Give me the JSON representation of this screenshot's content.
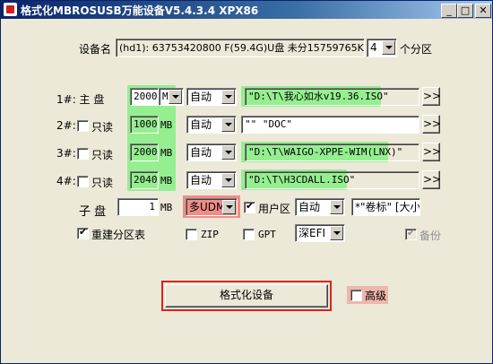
{
  "window": {
    "title": "格式化MBROSUSB万能设备V5.4.3.4 XPX86",
    "minimize_label": "_",
    "maximize_label": "□",
    "close_label": "✕"
  },
  "device": {
    "label": "设备名",
    "value": "(hd1): 63753420800 F(59.4G)U盘 未分15759765K (",
    "partition_count": "4",
    "partition_suffix": "个分区"
  },
  "partitions": [
    {
      "index_label": "1#: 主  盘",
      "size": "2000",
      "unit": "M",
      "mode": "自动",
      "path": "\"D:\\T\\我心如水v19.36.ISO\"",
      "browse": ">>"
    },
    {
      "index_label": "2#:",
      "readonly_label": "只读",
      "size": "1000",
      "unit": "MB",
      "mode": "自动",
      "path": "\"\"  \"DOC\"",
      "browse": ">>"
    },
    {
      "index_label": "3#:",
      "readonly_label": "只读",
      "size": "2000",
      "unit": "MB",
      "mode": "自动",
      "path": "\"D:\\T\\WAIGO-XPPE-WIM(LNX)\"",
      "browse": ">>"
    },
    {
      "index_label": "4#:",
      "readonly_label": "只读",
      "size": "2040",
      "unit": "MB",
      "mode": "自动",
      "path": "\"D:\\T\\H3CDALL.ISO\"",
      "browse": ">>"
    }
  ],
  "sub_disk": {
    "label": "子  盘",
    "size": "1",
    "unit": "MB",
    "mode": "多UDM第",
    "user_area_label": "用户区",
    "user_area_mode": "自动",
    "volume_label": "*\"卷标\" [大小"
  },
  "options": {
    "rebuild_label": "重建分区表",
    "zip_label": "ZIP",
    "gpt_label": "GPT",
    "efi_mode": "深EFI",
    "backup_label": "备份"
  },
  "actions": {
    "format_label": "格式化设备",
    "advanced_label": "高级"
  },
  "colors": {
    "highlight_green": "#78f078",
    "highlight_red": "#f06e6e",
    "box_red": "#e02020",
    "title_blue": "#0a246a"
  }
}
